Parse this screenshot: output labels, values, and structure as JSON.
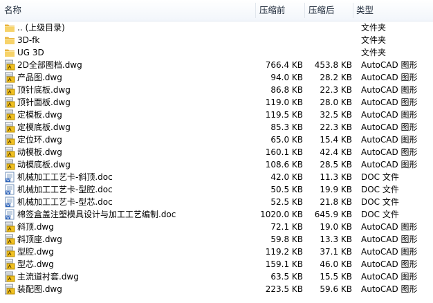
{
  "columns": {
    "name": "名称",
    "before": "压缩前",
    "after": "压缩后",
    "type": "类型"
  },
  "files": [
    {
      "icon": "folder-icon",
      "name": ".. (上级目录)",
      "before": "",
      "after": "",
      "type": "文件夹"
    },
    {
      "icon": "folder-icon",
      "name": "3D-fk",
      "before": "",
      "after": "",
      "type": "文件夹"
    },
    {
      "icon": "folder-icon",
      "name": "UG 3D",
      "before": "",
      "after": "",
      "type": "文件夹"
    },
    {
      "icon": "dwg-icon",
      "name": "2D全部图档.dwg",
      "before": "766.4 KB",
      "after": "453.8 KB",
      "type": "AutoCAD 图形"
    },
    {
      "icon": "dwg-icon",
      "name": "产品图.dwg",
      "before": "94.0 KB",
      "after": "28.2 KB",
      "type": "AutoCAD 图形"
    },
    {
      "icon": "dwg-icon",
      "name": "顶针底板.dwg",
      "before": "86.8 KB",
      "after": "22.3 KB",
      "type": "AutoCAD 图形"
    },
    {
      "icon": "dwg-icon",
      "name": "顶针面板.dwg",
      "before": "119.0 KB",
      "after": "28.0 KB",
      "type": "AutoCAD 图形"
    },
    {
      "icon": "dwg-icon",
      "name": "定模板.dwg",
      "before": "119.5 KB",
      "after": "32.5 KB",
      "type": "AutoCAD 图形"
    },
    {
      "icon": "dwg-icon",
      "name": "定模底板.dwg",
      "before": "85.3 KB",
      "after": "22.3 KB",
      "type": "AutoCAD 图形"
    },
    {
      "icon": "dwg-icon",
      "name": "定位环.dwg",
      "before": "65.0 KB",
      "after": "15.4 KB",
      "type": "AutoCAD 图形"
    },
    {
      "icon": "dwg-icon",
      "name": "动模板.dwg",
      "before": "160.1 KB",
      "after": "42.4 KB",
      "type": "AutoCAD 图形"
    },
    {
      "icon": "dwg-icon",
      "name": "动模底板.dwg",
      "before": "108.6 KB",
      "after": "28.5 KB",
      "type": "AutoCAD 图形"
    },
    {
      "icon": "doc-icon",
      "name": "机械加工工艺卡-斜顶.doc",
      "before": "42.0 KB",
      "after": "11.3 KB",
      "type": "DOC 文件"
    },
    {
      "icon": "doc-icon",
      "name": "机械加工工艺卡-型腔.doc",
      "before": "50.5 KB",
      "after": "19.9 KB",
      "type": "DOC 文件"
    },
    {
      "icon": "doc-icon",
      "name": "机械加工工艺卡-型芯.doc",
      "before": "52.5 KB",
      "after": "21.8 KB",
      "type": "DOC 文件"
    },
    {
      "icon": "doc-icon",
      "name": "棉签盒盖注塑模具设计与加工工艺编制.doc",
      "before": "1020.0 KB",
      "after": "645.9 KB",
      "type": "DOC 文件"
    },
    {
      "icon": "dwg-icon",
      "name": "斜顶.dwg",
      "before": "72.1 KB",
      "after": "19.0 KB",
      "type": "AutoCAD 图形"
    },
    {
      "icon": "dwg-icon",
      "name": "斜顶座.dwg",
      "before": "59.8 KB",
      "after": "13.3 KB",
      "type": "AutoCAD 图形"
    },
    {
      "icon": "dwg-icon",
      "name": "型腔.dwg",
      "before": "119.2 KB",
      "after": "37.1 KB",
      "type": "AutoCAD 图形"
    },
    {
      "icon": "dwg-icon",
      "name": "型芯.dwg",
      "before": "159.1 KB",
      "after": "46.0 KB",
      "type": "AutoCAD 图形"
    },
    {
      "icon": "dwg-icon",
      "name": "主流道衬套.dwg",
      "before": "63.5 KB",
      "after": "15.5 KB",
      "type": "AutoCAD 图形"
    },
    {
      "icon": "dwg-icon",
      "name": "装配图.dwg",
      "before": "223.5 KB",
      "after": "59.6 KB",
      "type": "AutoCAD 图形"
    }
  ]
}
